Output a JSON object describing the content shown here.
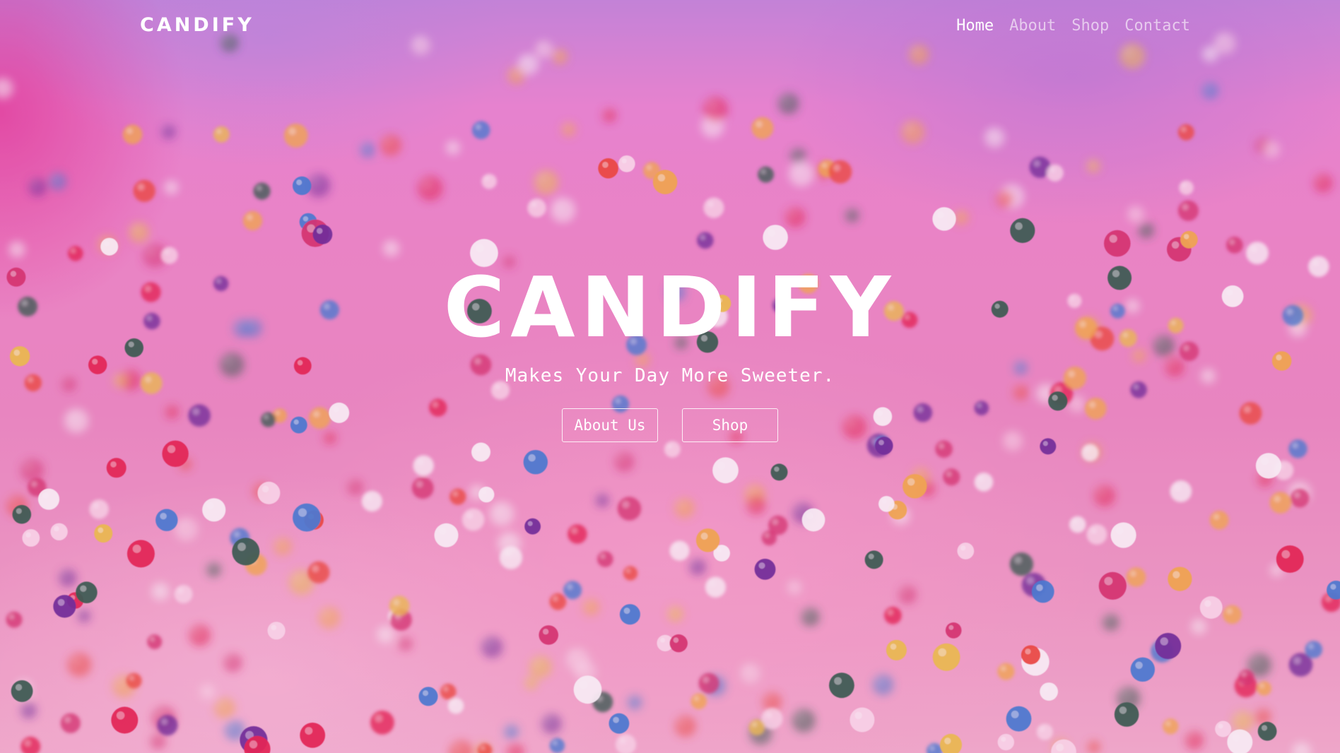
{
  "nav": {
    "brand": "CANDIFY",
    "links": [
      {
        "label": "Home",
        "active": true
      },
      {
        "label": "About",
        "active": false
      },
      {
        "label": "Shop",
        "active": false
      },
      {
        "label": "Contact",
        "active": false
      }
    ]
  },
  "hero": {
    "title": "CANDIFY",
    "tagline": "Makes Your Day More Sweeter.",
    "buttons": [
      {
        "label": "About Us"
      },
      {
        "label": "Shop"
      }
    ],
    "background_image": "pink-frosting-sprinkles-photo"
  },
  "colors": {
    "text": "#ffffff",
    "nav_inactive": "#ffffff99",
    "frosting_pink": "#ee8ec5",
    "top_lavender": "#c48ae0",
    "accent_magenta": "#e6288c"
  }
}
